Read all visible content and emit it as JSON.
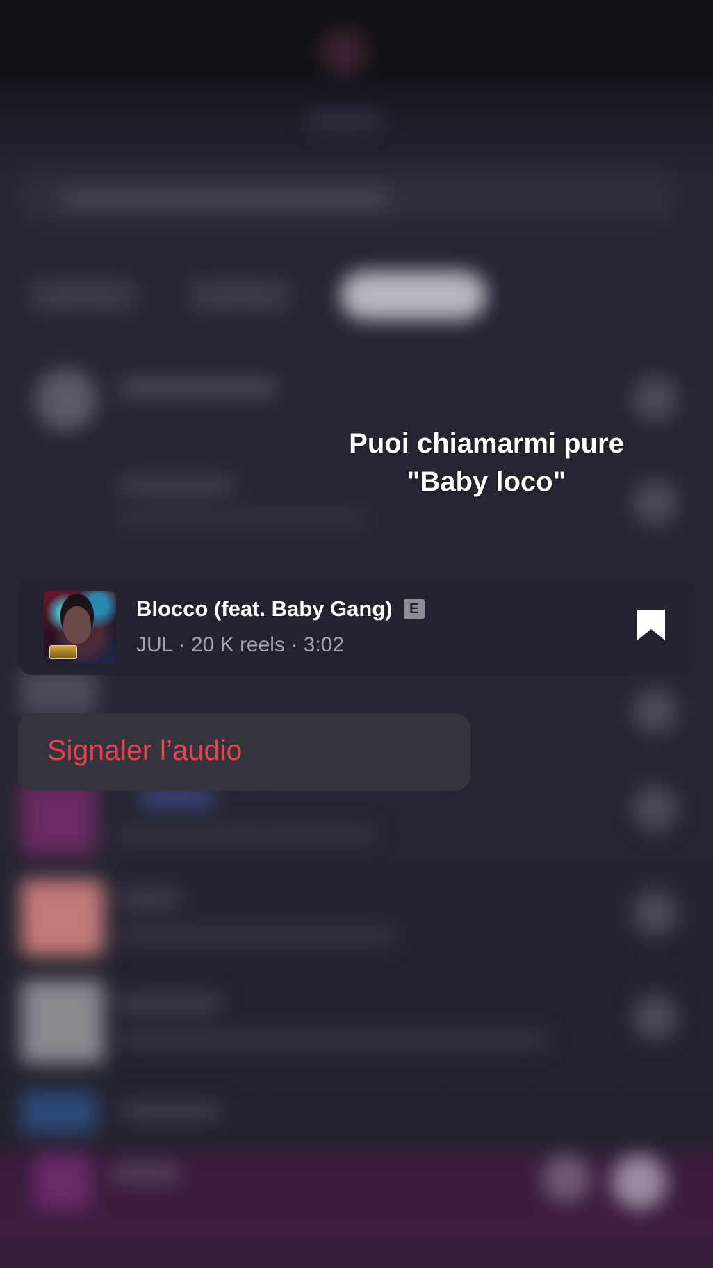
{
  "caption": {
    "line1": "Puoi chiamarmi pure",
    "line2": "\"Baby loco\""
  },
  "song": {
    "title": "Blocco (feat. Baby Gang)",
    "explicit_badge": "E",
    "meta": "JUL · 20 K reels · 3:02",
    "cover_icon": "album-cover",
    "bookmark_icon": "bookmark-icon"
  },
  "menu": {
    "items": [
      {
        "label": "Signaler l’audio",
        "color": "#e8414f"
      }
    ]
  },
  "colors": {
    "background": "#23222e",
    "card": "#23222e",
    "menu": "#35343c",
    "danger": "#e8414f",
    "meta_text": "#a4a3ad"
  }
}
